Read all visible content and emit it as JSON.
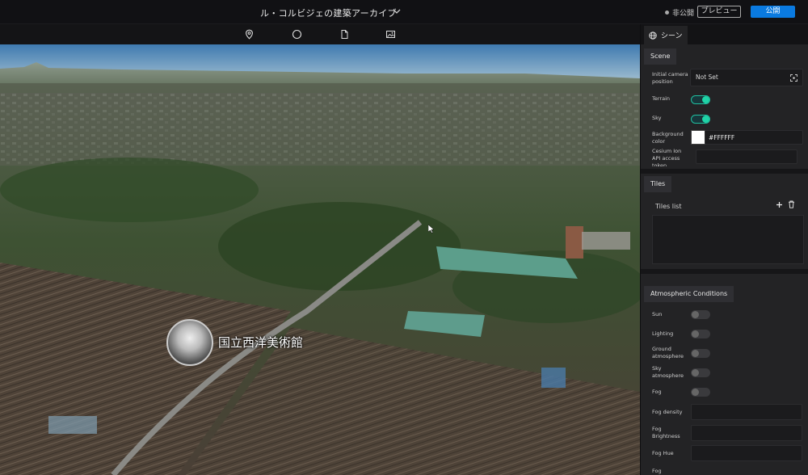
{
  "header": {
    "title": "ル・コルビジェの建築アーカイブ",
    "status": "非公開",
    "preview_label": "プレビュー",
    "publish_label": "公開"
  },
  "toolbar": {
    "icons": [
      "map-pin-icon",
      "circle-icon",
      "document-icon",
      "image-icon"
    ]
  },
  "map": {
    "marker_label": "国立西洋美術館"
  },
  "panel": {
    "tab_label": "シーン",
    "scene": {
      "section_title": "Scene",
      "camera_label": "Initial camera position",
      "camera_value": "Not Set",
      "terrain_label": "Terrain",
      "terrain_on": true,
      "sky_label": "Sky",
      "sky_on": true,
      "bg_label": "Background color",
      "bg_value": "#FFFFFF",
      "cesium_label": "Cesium Ion API access token"
    },
    "tiles": {
      "section_title": "Tiles",
      "list_label": "Tiles list"
    },
    "atmosphere": {
      "section_title": "Atmospheric Conditions",
      "sun_label": "Sun",
      "lighting_label": "Lighting",
      "ground_label": "Ground atmosphere",
      "sky_atmo_label": "Sky atmosphere",
      "fog_label": "Fog",
      "fog_density_label": "Fog density",
      "fog_brightness_label": "Fog Brightness",
      "fog_hue_label": "Fog Hue",
      "fog_more_label": "Fog"
    }
  },
  "colors": {
    "accent": "#0a7ae0",
    "toggle_on": "#1fd4a7"
  }
}
